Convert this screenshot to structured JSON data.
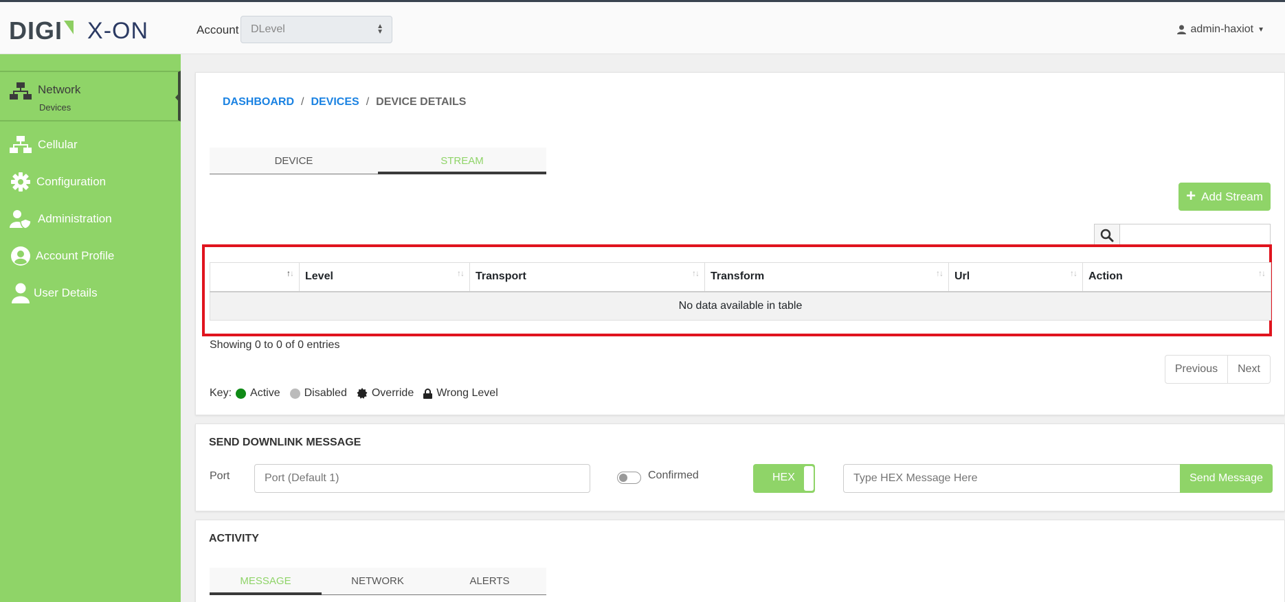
{
  "brand": {
    "logo_left": "DIGI",
    "logo_right": "X-ON"
  },
  "header": {
    "account_label": "Account",
    "account_value": "DLevel",
    "user": "admin-haxiot"
  },
  "sidebar": {
    "items": [
      {
        "label": "Network",
        "sub": "Devices",
        "icon": "network-icon"
      },
      {
        "label": "Cellular",
        "icon": "network-icon"
      },
      {
        "label": "Configuration",
        "icon": "gear-icon"
      },
      {
        "label": "Administration",
        "icon": "user-shield-icon"
      },
      {
        "label": "Account Profile",
        "icon": "user-circle-icon"
      },
      {
        "label": "User Details",
        "icon": "user-icon"
      }
    ]
  },
  "breadcrumb": {
    "home": "DASHBOARD",
    "sep": "/",
    "devices": "DEVICES",
    "current": "DEVICE DETAILS"
  },
  "device_tabs": {
    "device": "DEVICE",
    "stream": "STREAM",
    "active": "STREAM"
  },
  "add_stream_label": "Add Stream",
  "table": {
    "columns": [
      "",
      "Level",
      "Transport",
      "Transform",
      "Url",
      "Action"
    ],
    "empty_message": "No data available in table"
  },
  "showing_text": "Showing 0 to 0 of 0 entries",
  "pagination": {
    "previous": "Previous",
    "next": "Next"
  },
  "key": {
    "label": "Key:",
    "active": "Active",
    "disabled": "Disabled",
    "override": "Override",
    "wrong_level": "Wrong Level"
  },
  "downlink": {
    "title": "SEND DOWNLINK MESSAGE",
    "port_label": "Port",
    "port_placeholder": "Port (Default 1)",
    "confirmed_label": "Confirmed",
    "hex_label": "HEX",
    "message_placeholder": "Type HEX Message Here",
    "send_label": "Send Message"
  },
  "activity": {
    "title": "ACTIVITY",
    "tabs": [
      "MESSAGE",
      "NETWORK",
      "ALERTS"
    ],
    "active": "MESSAGE"
  },
  "colors": {
    "accent": "#8fd468",
    "link": "#1a82e2",
    "highlight": "#e0141e",
    "active_dot": "#0f8a16"
  }
}
